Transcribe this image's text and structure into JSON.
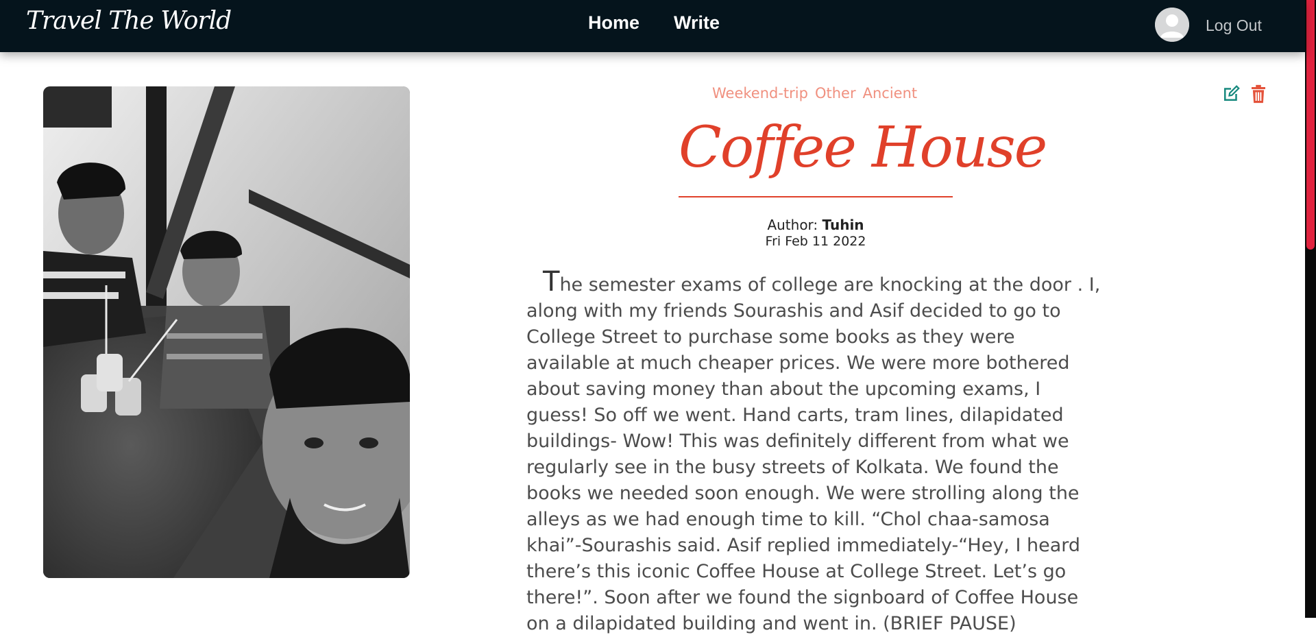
{
  "nav": {
    "brand": "Travel The World",
    "links": [
      "Home",
      "Write"
    ],
    "logout": "Log Out"
  },
  "post": {
    "tags": [
      "Weekend-trip",
      "Other",
      "Ancient"
    ],
    "title": "Coffee House",
    "author_label": "Author:",
    "author": "Tuhin",
    "date": "Fri Feb 11 2022",
    "body_first_letter": "T",
    "body_rest": "he semester exams of college are knocking at the door . I, along with my friends Sourashis and Asif decided to go to College Street to purchase some books as they were available at much cheaper prices. We were more bothered about saving money than about the upcoming exams, I guess! So off we went. Hand carts, tram lines, dilapidated buildings- Wow! This was definitely different from what we regularly see in the busy streets of Kolkata. We found the books we needed soon enough. We were strolling along the alleys as we had enough time to kill. “Chol chaa-samosa khai”-Sourashis said. Asif replied immediately-“Hey, I heard there’s this iconic Coffee House at College Street. Let’s go there!”. Soon after we found the signboard of Coffee House on a dilapidated building and went in. (BRIEF PAUSE)"
  },
  "colors": {
    "navbar_bg": "#05141c",
    "title": "#e0402a",
    "tags": "#f0907f",
    "edit_icon": "#17897e",
    "delete_icon": "#e4523a",
    "scroll_accent": "#e0233f"
  },
  "icons": [
    "user-avatar-icon",
    "edit-icon",
    "trash-icon"
  ]
}
